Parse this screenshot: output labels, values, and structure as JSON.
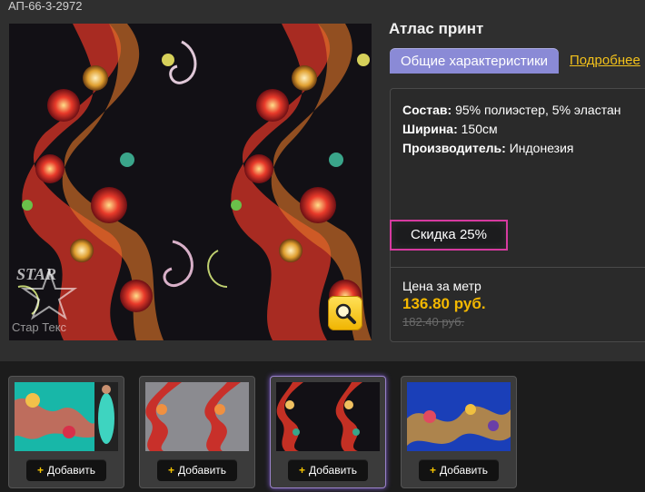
{
  "header": {
    "article": "АП-66-3-2972"
  },
  "product": {
    "title": "Атлас принт",
    "tabs": {
      "general": "Общие характеристики",
      "details": "Подробнее"
    },
    "specs": [
      {
        "label": "Состав:",
        "value": "95% полиэстер, 5% эластан"
      },
      {
        "label": "Ширина:",
        "value": "150см"
      },
      {
        "label": "Производитель:",
        "value": "Индонезия"
      }
    ],
    "discount": "Скидка 25%",
    "price": {
      "label": "Цена за метр",
      "new": "136.80 руб.",
      "old": "182.40 руб."
    }
  },
  "image": {
    "watermark_text": "Стар Текс",
    "zoom_icon": "magnifier-icon"
  },
  "thumbnails": [
    {
      "add_label": "Добавить",
      "theme": "turquoise"
    },
    {
      "add_label": "Добавить",
      "theme": "grey-red"
    },
    {
      "add_label": "Добавить",
      "theme": "black-floral",
      "active": true
    },
    {
      "add_label": "Добавить",
      "theme": "blue-floral"
    }
  ],
  "colors": {
    "accent_tab": "#8a8ad6",
    "link": "#f3c21b",
    "price": "#f4b800",
    "discount_border": "#d63aa0"
  }
}
